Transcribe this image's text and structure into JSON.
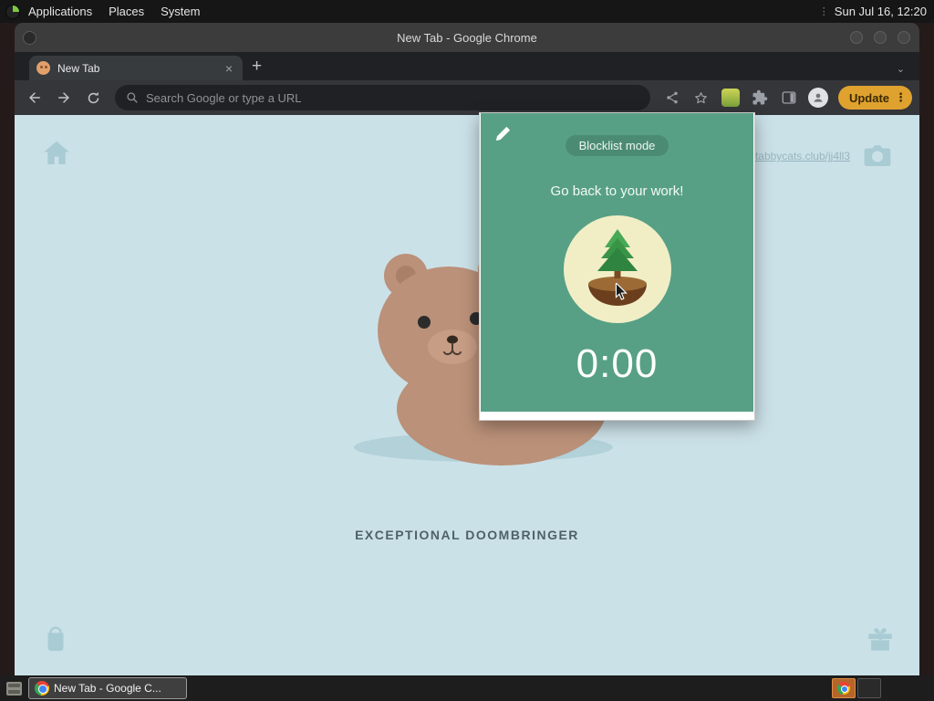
{
  "desktop": {
    "menus": [
      {
        "label": "Applications"
      },
      {
        "label": "Places"
      },
      {
        "label": "System"
      }
    ],
    "clock": "Sun Jul 16, 12:20",
    "taskbar_task": "New Tab - Google C..."
  },
  "window": {
    "title": "New Tab - Google Chrome"
  },
  "browser": {
    "tab_title": "New Tab",
    "close_glyph": "×",
    "new_tab_glyph": "+",
    "chevron_glyph": "⌄",
    "address_placeholder": "Search Google or type a URL",
    "update_label": "Update",
    "kebab_glyph": "⋮"
  },
  "page": {
    "link_text": "tabbycats.club/jj4ll3",
    "cat_name": "EXCEPTIONAL DOOMBRINGER"
  },
  "popup": {
    "mode_label": "Blocklist mode",
    "message": "Go back to your work!",
    "timer": "0:00"
  },
  "colors": {
    "page_bg": "#cbe1e8",
    "popup_green": "#57a086",
    "pill_green": "#4b8b74",
    "update_orange": "#dfa22f",
    "page_icon": "#a9ccd4"
  }
}
